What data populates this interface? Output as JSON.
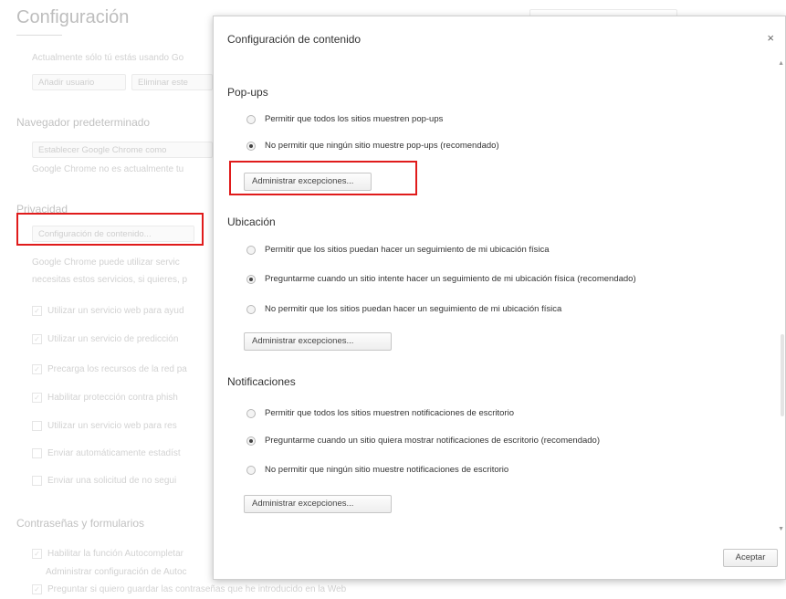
{
  "background": {
    "title": "Configuración",
    "lines": [
      "Actualmente sólo tú estás usando Go",
      "Navegador predeterminado",
      "Google Chrome no es actualmente tu",
      "Privacidad",
      "Google Chrome puede utilizar servic",
      "necesitas estos servicios, si quieres, p",
      "Contraseñas y formularios",
      "Habilitar la función Autocompletar",
      "Administrar configuración de Autoc",
      "Preguntar si quiero guardar las contraseñas que he introducido en la Web"
    ],
    "buttons": [
      "Añadir usuario",
      "Eliminar este",
      "Establecer Google Chrome como",
      "Configuración de contenido..."
    ],
    "checks": [
      {
        "label": "Utilizar un servicio web para ayud",
        "checked": true
      },
      {
        "label": "Utilizar un servicio de predicción",
        "checked": true
      },
      {
        "label": "Precarga los recursos de la red pa",
        "checked": true
      },
      {
        "label": "Habilitar protección contra phish",
        "checked": true
      },
      {
        "label": "Utilizar un servicio web para res",
        "checked": false
      },
      {
        "label": "Enviar automáticamente estadíst",
        "checked": false
      },
      {
        "label": "Enviar una solicitud de no segui",
        "checked": false
      }
    ]
  },
  "dialog": {
    "title": "Configuración de contenido",
    "close_glyph": "×",
    "sections": [
      {
        "heading": "Pop-ups",
        "options": [
          {
            "label": "Permitir que todos los sitios muestren pop-ups",
            "selected": false
          },
          {
            "label": "No permitir que ningún sitio muestre pop-ups (recomendado)",
            "selected": true
          }
        ],
        "button": "Administrar excepciones..."
      },
      {
        "heading": "Ubicación",
        "options": [
          {
            "label": "Permitir que los sitios puedan hacer un seguimiento de mi ubicación física",
            "selected": false
          },
          {
            "label": "Preguntarme cuando un sitio intente hacer un seguimiento de mi ubicación física (recomendado)",
            "selected": true
          },
          {
            "label": "No permitir que los sitios puedan hacer un seguimiento de mi ubicación física",
            "selected": false
          }
        ],
        "button": "Administrar excepciones..."
      },
      {
        "heading": "Notificaciones",
        "options": [
          {
            "label": "Permitir que todos los sitios muestren notificaciones de escritorio",
            "selected": false
          },
          {
            "label": "Preguntarme cuando un sitio quiera mostrar notificaciones de escritorio (recomendado)",
            "selected": true
          },
          {
            "label": "No permitir que ningún sitio muestre notificaciones de escritorio",
            "selected": false
          }
        ],
        "button": "Administrar excepciones..."
      }
    ],
    "accept_label": "Aceptar"
  },
  "colors": {
    "highlight": "#e01b1b"
  }
}
